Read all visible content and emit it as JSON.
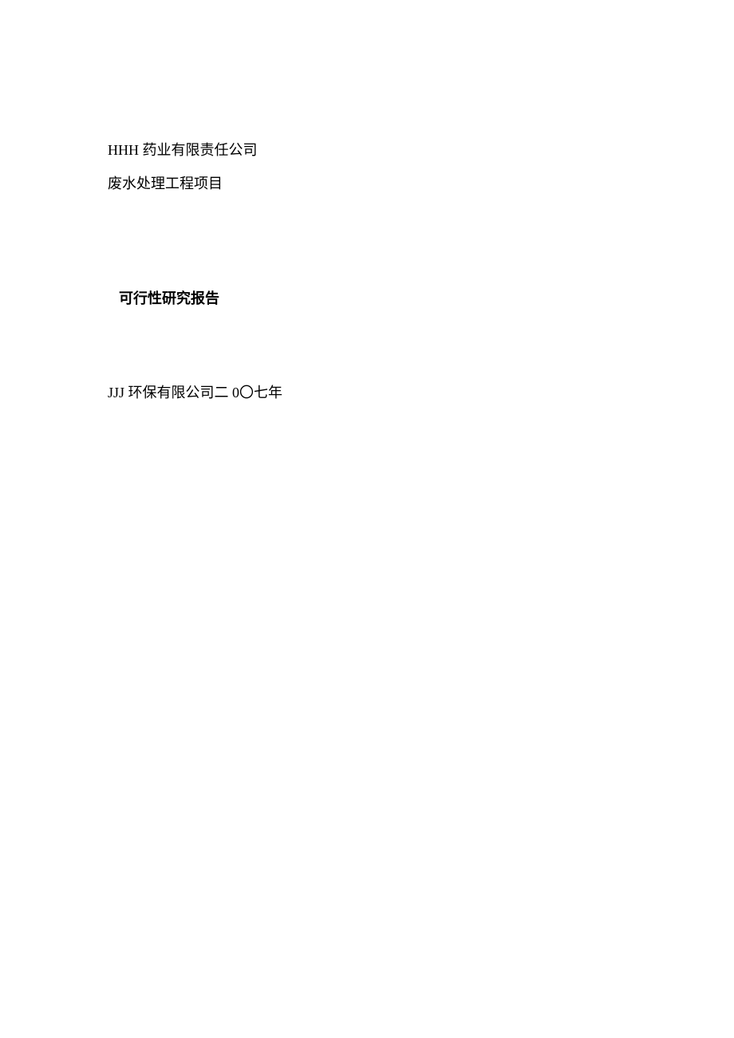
{
  "company": "HHH 药业有限责任公司",
  "project": "废水处理工程项目",
  "reportTitle": "可行性研究报告",
  "author": "JJJ 环保有限公司二 0〇七年"
}
